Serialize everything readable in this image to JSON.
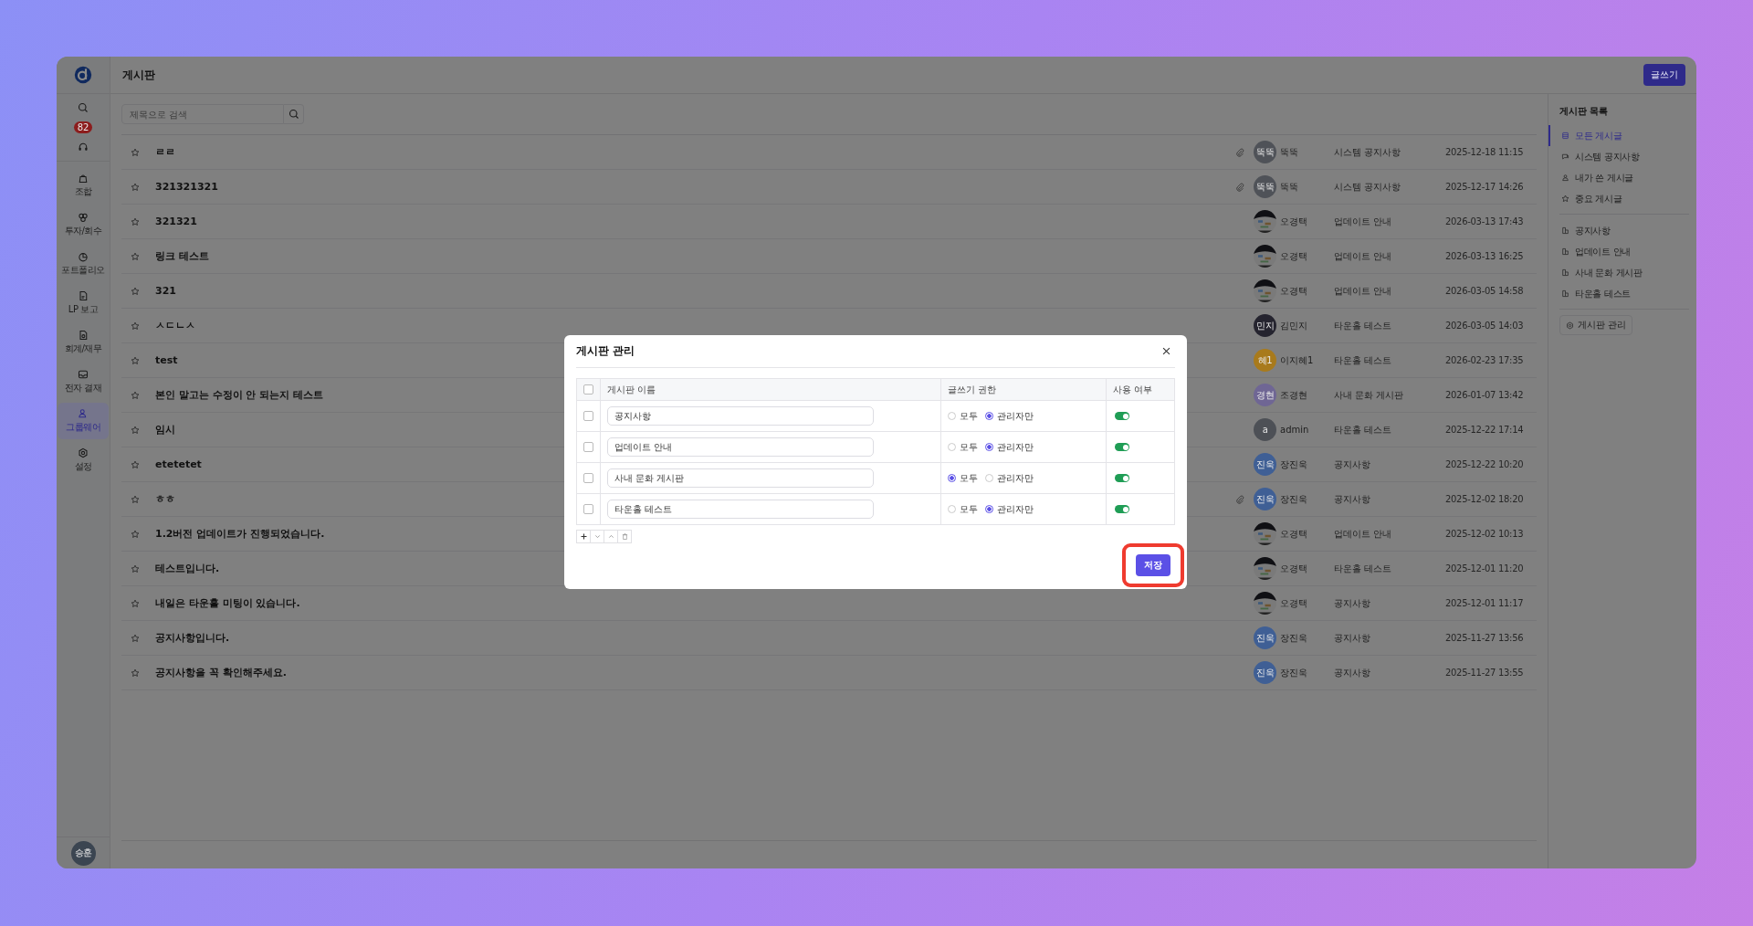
{
  "sidebar": {
    "notification_count": "82",
    "items": [
      {
        "label": "조합",
        "selected": false
      },
      {
        "label": "투자/회수",
        "selected": false
      },
      {
        "label": "포트폴리오",
        "selected": false
      },
      {
        "label": "LP 보고",
        "selected": false
      },
      {
        "label": "회계/재무",
        "selected": false
      },
      {
        "label": "전자 결재",
        "selected": false
      },
      {
        "label": "그룹웨어",
        "selected": true
      },
      {
        "label": "설정",
        "selected": false
      }
    ],
    "user_initials": "승훈"
  },
  "header": {
    "title": "게시판",
    "write_button": "글쓰기"
  },
  "search": {
    "placeholder": "제목으로 검색"
  },
  "posts": [
    {
      "title": "ㄹㄹ",
      "starred": false,
      "attachment": true,
      "avatar": {
        "kind": "initials",
        "initials": "뚝뚝",
        "color": "#4f5258"
      },
      "author": "뚝뚝",
      "board": "시스템 공지사항",
      "date": "2025-12-18 11:15"
    },
    {
      "title": "321321321",
      "starred": false,
      "attachment": true,
      "avatar": {
        "kind": "initials",
        "initials": "뚝뚝",
        "color": "#4f5258"
      },
      "author": "뚝뚝",
      "board": "시스템 공지사항",
      "date": "2025-12-17 14:26"
    },
    {
      "title": "321321",
      "starred": false,
      "attachment": false,
      "author": "오경택",
      "board": "업데이트 안내",
      "date": "2026-03-13 17:43"
    },
    {
      "title": "링크 테스트",
      "starred": false,
      "attachment": false,
      "author": "오경택",
      "board": "업데이트 안내",
      "date": "2026-03-13 16:25"
    },
    {
      "title": "321",
      "starred": false,
      "attachment": false,
      "author": "오경택",
      "board": "업데이트 안내",
      "date": "2026-03-05 14:58"
    },
    {
      "title": "ㅅㄷㄴㅅ",
      "starred": false,
      "attachment": false,
      "avatar": {
        "kind": "initials",
        "initials": "민지",
        "color": "#25242f"
      },
      "author": "김민지",
      "board": "타운홀 테스트",
      "date": "2026-03-05 14:03"
    },
    {
      "title": "test",
      "starred": false,
      "attachment": false,
      "avatar": {
        "kind": "initials",
        "initials": "혜1",
        "color": "#a87a1c"
      },
      "author": "이지혜1",
      "board": "타운홀 테스트",
      "date": "2026-02-23 17:35"
    },
    {
      "title": "본인 말고는 수정이 안 되는지 테스트",
      "starred": false,
      "attachment": false,
      "avatar": {
        "kind": "initials",
        "initials": "경현",
        "color": "#6f6694"
      },
      "author": "조경현",
      "board": "사내 문화 게시판",
      "date": "2026-01-07 13:42"
    },
    {
      "title": "임시",
      "starred": false,
      "attachment": false,
      "avatar": {
        "kind": "initials",
        "initials": "a",
        "color": "#4d5056"
      },
      "author": "admin",
      "board": "타운홀 테스트",
      "date": "2025-12-22 17:14"
    },
    {
      "title": "etetetet",
      "starred": false,
      "attachment": false,
      "avatar": {
        "kind": "initials",
        "initials": "진욱",
        "color": "#3f5f95"
      },
      "author": "장진욱",
      "board": "공지사항",
      "date": "2025-12-22 10:20"
    },
    {
      "title": "ㅎㅎ",
      "starred": false,
      "attachment": true,
      "avatar": {
        "kind": "initials",
        "initials": "진욱",
        "color": "#3f5f95"
      },
      "author": "장진욱",
      "board": "공지사항",
      "date": "2025-12-02 18:20"
    },
    {
      "title": "1.2버전 업데이트가 진행되었습니다.",
      "starred": false,
      "attachment": false,
      "author": "오경택",
      "board": "업데이트 안내",
      "date": "2025-12-02 10:13"
    },
    {
      "title": "테스트입니다.",
      "starred": false,
      "attachment": false,
      "author": "오경택",
      "board": "타운홀 테스트",
      "date": "2025-12-01 11:20"
    },
    {
      "title": "내일은 타운홀 미팅이 있습니다.",
      "starred": false,
      "attachment": false,
      "author": "오경택",
      "board": "공지사항",
      "date": "2025-12-01 11:17"
    },
    {
      "title": "공지사항입니다.",
      "starred": false,
      "attachment": false,
      "avatar": {
        "kind": "initials",
        "initials": "진욱",
        "color": "#3f5f95"
      },
      "author": "장진욱",
      "board": "공지사항",
      "date": "2025-11-27 13:56"
    },
    {
      "title": "공지사항을 꼭 확인해주세요.",
      "starred": false,
      "attachment": false,
      "avatar": {
        "kind": "initials",
        "initials": "진욱",
        "color": "#3f5f95"
      },
      "author": "장진욱",
      "board": "공지사항",
      "date": "2025-11-27 13:55"
    }
  ],
  "board_panel": {
    "title": "게시판 목록",
    "filters": [
      {
        "label": "모든 게시글",
        "selected": true
      },
      {
        "label": "시스템 공지사항",
        "selected": false
      },
      {
        "label": "내가 쓴 게시글",
        "selected": false
      },
      {
        "label": "중요 게시글",
        "selected": false
      }
    ],
    "boards": [
      {
        "label": "공지사항",
        "selected": false
      },
      {
        "label": "업데이트 안내",
        "selected": false
      },
      {
        "label": "사내 문화 게시판",
        "selected": false
      },
      {
        "label": "타운홀 테스트",
        "selected": false
      }
    ],
    "manage_button": "게시판 관리"
  },
  "modal": {
    "title": "게시판 관리",
    "all_checked": false,
    "columns": [
      "게시판 이름",
      "글쓰기 권한",
      "사용 여부"
    ],
    "rows": [
      {
        "checked": false,
        "name": "공지사항",
        "permission_options": [
          {
            "label": "모두",
            "selected": false
          },
          {
            "label": "관리자만",
            "selected": true
          }
        ],
        "enabled": true
      },
      {
        "checked": false,
        "name": "업데이트 안내",
        "permission_options": [
          {
            "label": "모두",
            "selected": false
          },
          {
            "label": "관리자만",
            "selected": true
          }
        ],
        "enabled": true
      },
      {
        "checked": false,
        "name": "사내 문화 게시판",
        "permission_options": [
          {
            "label": "모두",
            "selected": true
          },
          {
            "label": "관리자만",
            "selected": false
          }
        ],
        "enabled": true
      },
      {
        "checked": false,
        "name": "타운홀 테스트",
        "permission_options": [
          {
            "label": "모두",
            "selected": false
          },
          {
            "label": "관리자만",
            "selected": true
          }
        ],
        "enabled": true
      }
    ],
    "save_button": {
      "label": "저장",
      "highlighted": true
    }
  }
}
